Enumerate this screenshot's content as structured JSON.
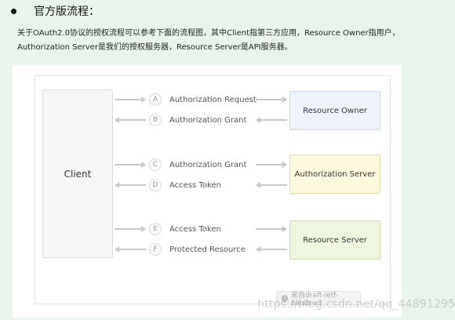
{
  "heading": "官方版流程：",
  "description": {
    "line1": "关于OAuth2.0协议的授权流程可以参考下面的流程图，其中Client指第三方应用，Resource Owner指用户，",
    "line2": "Authorization Server是我们的授权服务器，Resource Server是API服务器。"
  },
  "diagram": {
    "client": "Client",
    "servers": {
      "owner": "Resource Owner",
      "auth": "Authorization Server",
      "resource": "Resource Server"
    },
    "steps": [
      {
        "letter": "A",
        "label": "Authorization Request"
      },
      {
        "letter": "B",
        "label": "Authorization Grant"
      },
      {
        "letter": "C",
        "label": "Authorization Grant"
      },
      {
        "letter": "D",
        "label": "Access Token"
      },
      {
        "letter": "E",
        "label": "Access Token"
      },
      {
        "letter": "F",
        "label": "Protected Resource"
      }
    ],
    "source_tag": "来自draft-ietf-oauth-v2"
  },
  "watermark": "https://blog.csdn.net/qq_44891295"
}
